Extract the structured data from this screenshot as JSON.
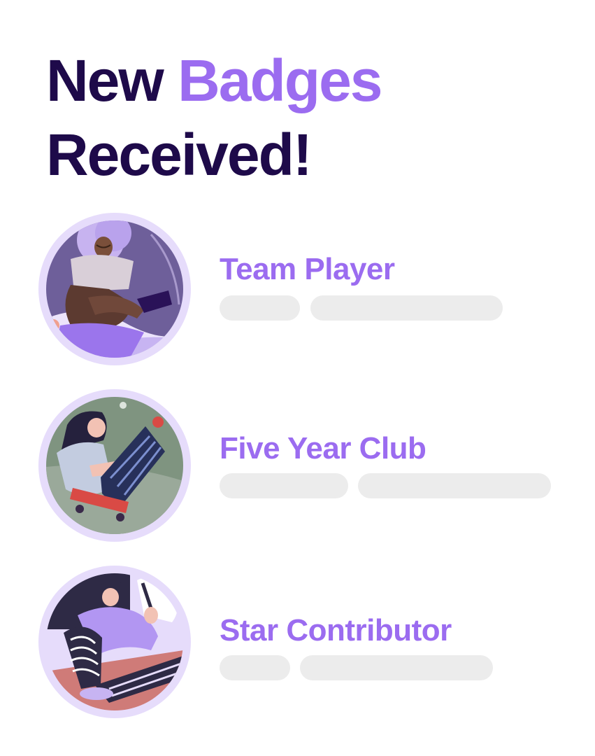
{
  "header": {
    "line1_part1": "New",
    "line1_part2": "Badges",
    "line2": "Received!"
  },
  "colors": {
    "heading": "#1e0a4a",
    "accent": "#9b6cf0",
    "ring": "#e6dcfb",
    "placeholder": "#ececec"
  },
  "badges": [
    {
      "title": "Team Player",
      "icon": "team-player-illustration-icon"
    },
    {
      "title": "Five Year Club",
      "icon": "five-year-club-illustration-icon"
    },
    {
      "title": "Star Contributor",
      "icon": "star-contributor-illustration-icon"
    }
  ]
}
